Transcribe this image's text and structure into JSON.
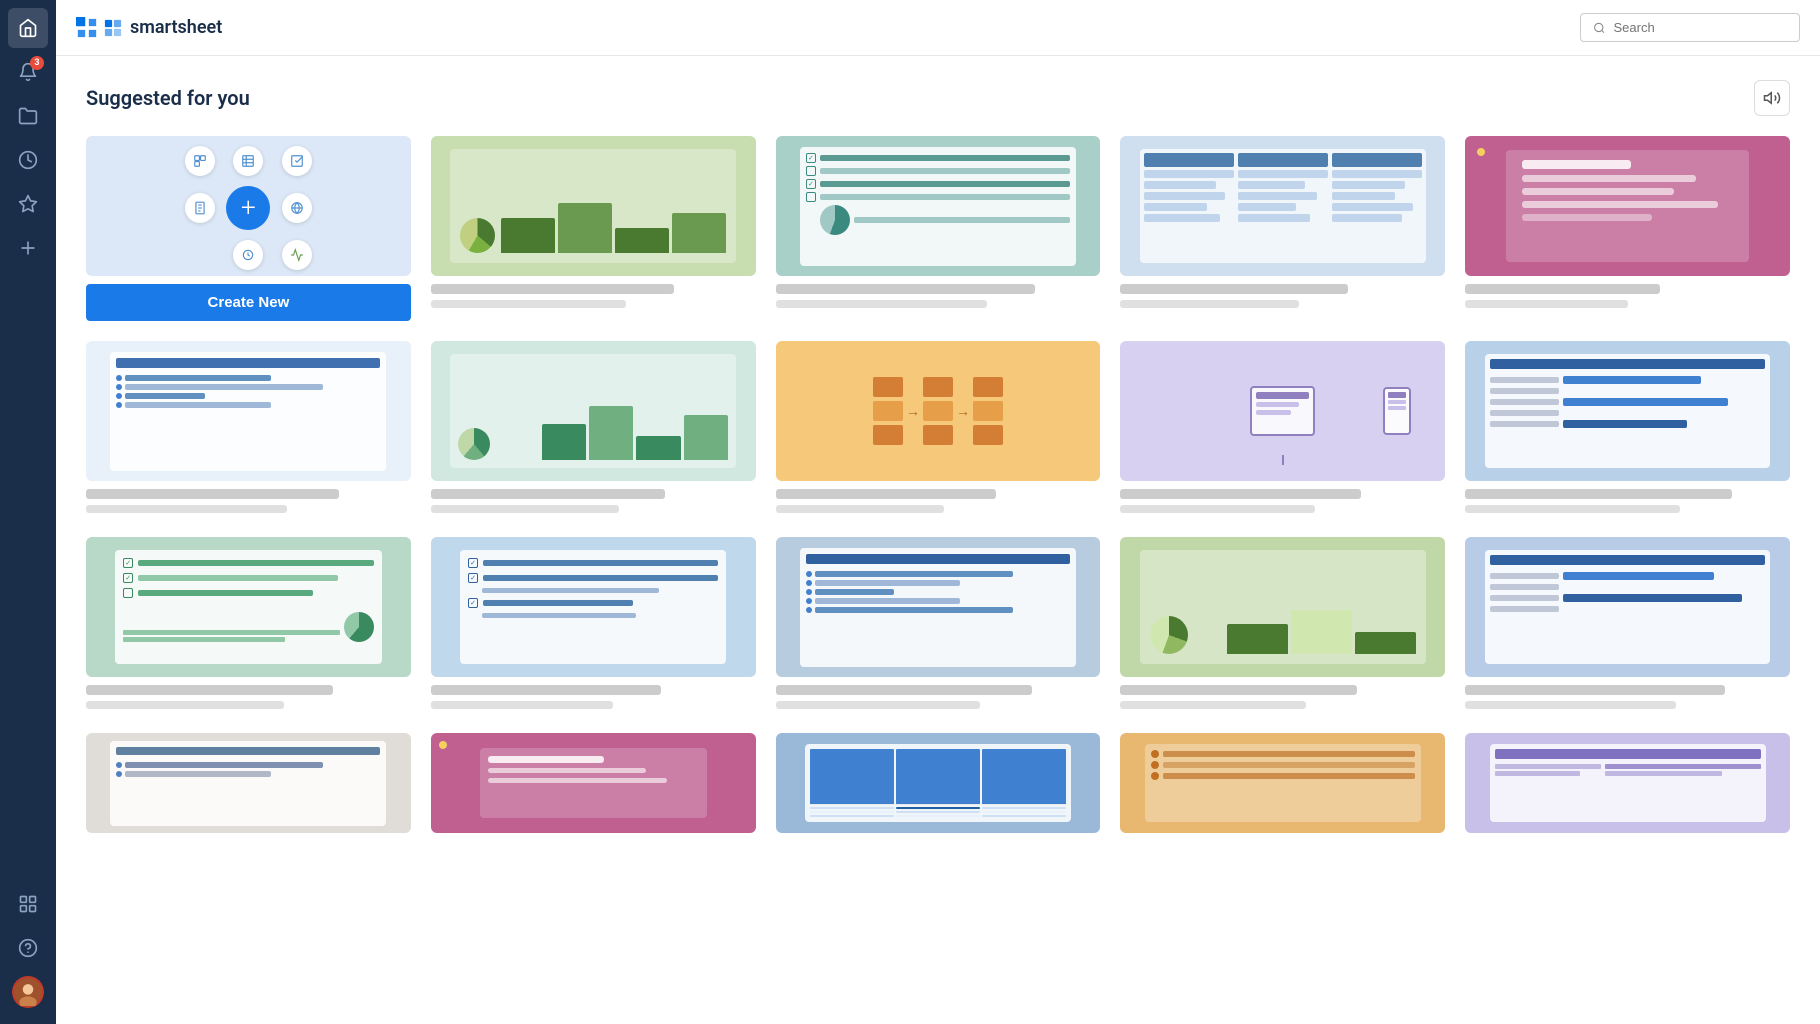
{
  "app": {
    "name": "smartsheet",
    "logo_text": "smartsheet"
  },
  "header": {
    "search_placeholder": "Search"
  },
  "sidebar": {
    "items": [
      {
        "name": "home",
        "icon": "⌂",
        "active": true
      },
      {
        "name": "notifications",
        "icon": "🔔",
        "badge": "3"
      },
      {
        "name": "browse",
        "icon": "📁"
      },
      {
        "name": "recent",
        "icon": "🕐"
      },
      {
        "name": "favorites",
        "icon": "★"
      },
      {
        "name": "add",
        "icon": "+"
      }
    ],
    "bottom_items": [
      {
        "name": "apps",
        "icon": "⋮⋮⋮"
      },
      {
        "name": "help",
        "icon": "?"
      }
    ]
  },
  "section": {
    "title": "Suggested for you",
    "announce_label": "📢"
  },
  "create_new": {
    "button_label": "Create New"
  },
  "templates": [
    {
      "id": 1,
      "type": "chart",
      "bg": "#c8ddb0",
      "title_width": "75%",
      "sub_width": "60%"
    },
    {
      "id": 2,
      "type": "report-teal",
      "bg": "#a8cfc8",
      "title_width": "80%",
      "sub_width": "65%"
    },
    {
      "id": 3,
      "type": "two-panel",
      "bg": "#cfdff0",
      "title_width": "70%",
      "sub_width": "55%"
    },
    {
      "id": 4,
      "type": "pink-report",
      "bg": "#c06090",
      "title_width": "60%",
      "sub_width": "50%"
    },
    {
      "id": 5,
      "type": "sheet",
      "bg": "#e8f0fa",
      "title_width": "78%",
      "sub_width": "62%"
    },
    {
      "id": 6,
      "type": "chart-green",
      "bg": "#dce8f0",
      "title_width": "72%",
      "sub_width": "58%"
    },
    {
      "id": 7,
      "type": "flow-orange",
      "bg": "#f5c87a",
      "title_width": "68%",
      "sub_width": "52%"
    },
    {
      "id": 8,
      "type": "device-purple",
      "bg": "#d8d0f0",
      "title_width": "74%",
      "sub_width": "60%"
    },
    {
      "id": 9,
      "type": "gantt-blue",
      "bg": "#b8d0e8",
      "title_width": "82%",
      "sub_width": "66%"
    },
    {
      "id": 10,
      "type": "checklist-green",
      "bg": "#b8d8c8",
      "title_width": "76%",
      "sub_width": "61%"
    },
    {
      "id": 11,
      "type": "checklist-blue",
      "bg": "#c0d8ec",
      "title_width": "71%",
      "sub_width": "56%"
    },
    {
      "id": 12,
      "type": "sheet-blue2",
      "bg": "#b8cce0",
      "title_width": "79%",
      "sub_width": "63%"
    },
    {
      "id": 13,
      "type": "chart2",
      "bg": "#c0d8a8",
      "title_width": "73%",
      "sub_width": "57%"
    },
    {
      "id": 14,
      "type": "gantt2",
      "bg": "#b8cce8",
      "title_width": "80%",
      "sub_width": "65%"
    },
    {
      "id": 15,
      "type": "sheet-bottom",
      "bg": "#e0d8d0",
      "title_width": "69%",
      "sub_width": "54%"
    },
    {
      "id": 16,
      "type": "pink2-bottom",
      "bg": "#c06090",
      "title_width": "77%",
      "sub_width": "62%"
    },
    {
      "id": 17,
      "type": "blue-table-bottom",
      "bg": "#9ab8d8",
      "title_width": "74%",
      "sub_width": "59%"
    },
    {
      "id": 18,
      "type": "orange-bottom",
      "bg": "#e8b870",
      "title_width": "70%",
      "sub_width": "55%"
    },
    {
      "id": 19,
      "type": "purple-bottom",
      "bg": "#c8c0e8",
      "title_width": "83%",
      "sub_width": "67%"
    }
  ]
}
